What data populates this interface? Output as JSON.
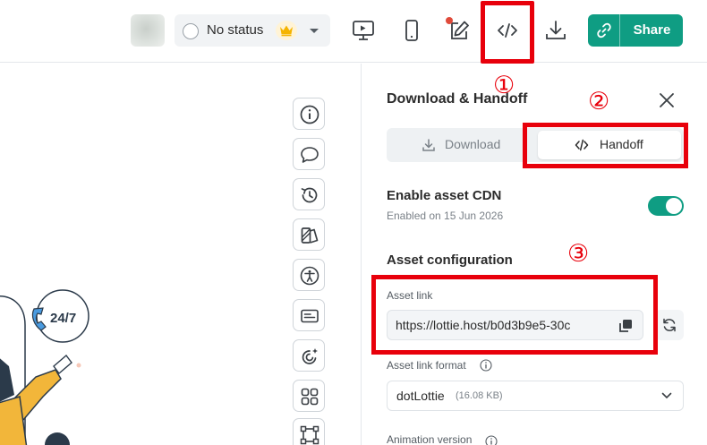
{
  "topbar": {
    "status_label": "No status",
    "share_label": "Share",
    "icons": [
      "preview-desktop-icon",
      "preview-mobile-icon",
      "edit-icon",
      "code-icon",
      "download-icon",
      "link-icon"
    ]
  },
  "panel": {
    "title": "Download & Handoff",
    "tabs": [
      {
        "label": "Download",
        "active": false
      },
      {
        "label": "Handoff",
        "active": true
      }
    ],
    "cdn": {
      "title": "Enable asset CDN",
      "subtitle": "Enabled on 15 Jun 2026",
      "enabled": true
    },
    "config_title": "Asset configuration",
    "asset_link": {
      "label": "Asset link",
      "value": "https://lottie.host/b0d3b9e5-30c"
    },
    "format": {
      "label": "Asset link format",
      "value": "dotLottie",
      "size": "(16.08 KB)"
    },
    "animation_version_label": "Animation version"
  },
  "side_toolbar_icons": [
    "info-icon",
    "comment-icon",
    "history-icon",
    "theme-icon",
    "accessibility-icon",
    "captions-icon",
    "ai-magic-icon",
    "components-icon",
    "frame-icon"
  ],
  "illustration": {
    "badge_text": "24/7"
  },
  "annotations": [
    "①",
    "②",
    "③"
  ],
  "colors": {
    "accent": "#0f9d83",
    "annotation": "#e8000b"
  }
}
